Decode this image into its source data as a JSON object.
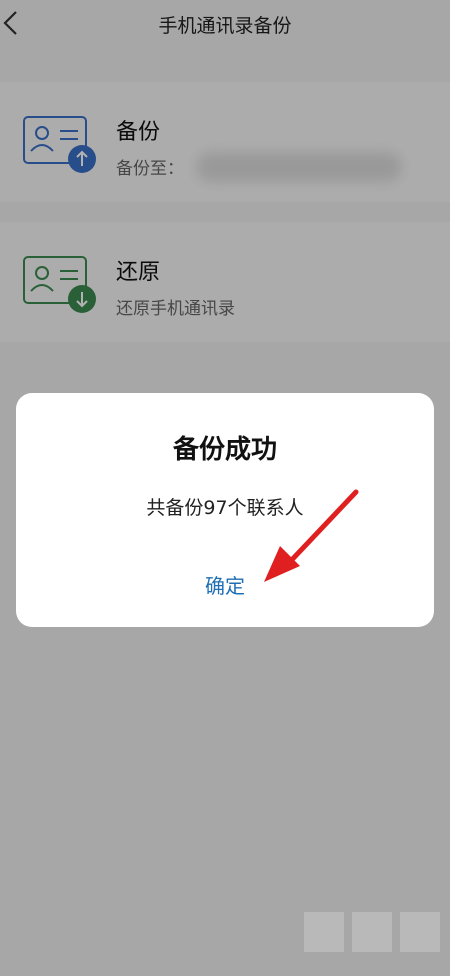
{
  "header": {
    "title": "手机通讯录备份"
  },
  "backup": {
    "label": "备份",
    "sub_prefix": "备份至："
  },
  "restore": {
    "label": "还原",
    "sub": "还原手机通讯录"
  },
  "dialog": {
    "title": "备份成功",
    "message": "共备份97个联系人",
    "ok": "确定"
  },
  "colors": {
    "accent_blue": "#1e6fb5",
    "upload_badge": "#3a6fc7",
    "download_badge": "#3c8a4f",
    "annotation_red": "#e02020"
  }
}
